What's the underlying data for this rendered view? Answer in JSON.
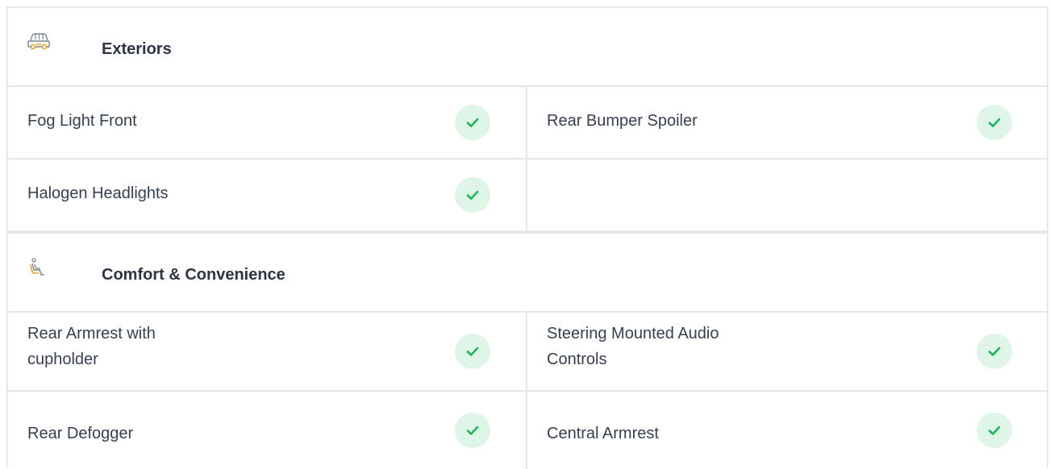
{
  "sections": [
    {
      "title": "Exteriors",
      "icon": "car-exterior-icon",
      "items": [
        {
          "label": "Fog Light Front",
          "available": true
        },
        {
          "label": "Rear Bumper Spoiler",
          "available": true
        },
        {
          "label": "Halogen Headlights",
          "available": true
        }
      ]
    },
    {
      "title": "Comfort & Convenience",
      "icon": "car-seat-icon",
      "items": [
        {
          "label": "Rear Armrest with cupholder",
          "available": true
        },
        {
          "label": "Steering Mounted Audio Controls",
          "available": true
        },
        {
          "label": "Rear Defogger",
          "available": true
        },
        {
          "label": "Central Armrest",
          "available": true
        }
      ]
    }
  ],
  "colors": {
    "accent_check": "#1fb65f",
    "check_bg": "#dff5e8",
    "icon_orange": "#f0a020",
    "border": "#e3e8ef"
  }
}
